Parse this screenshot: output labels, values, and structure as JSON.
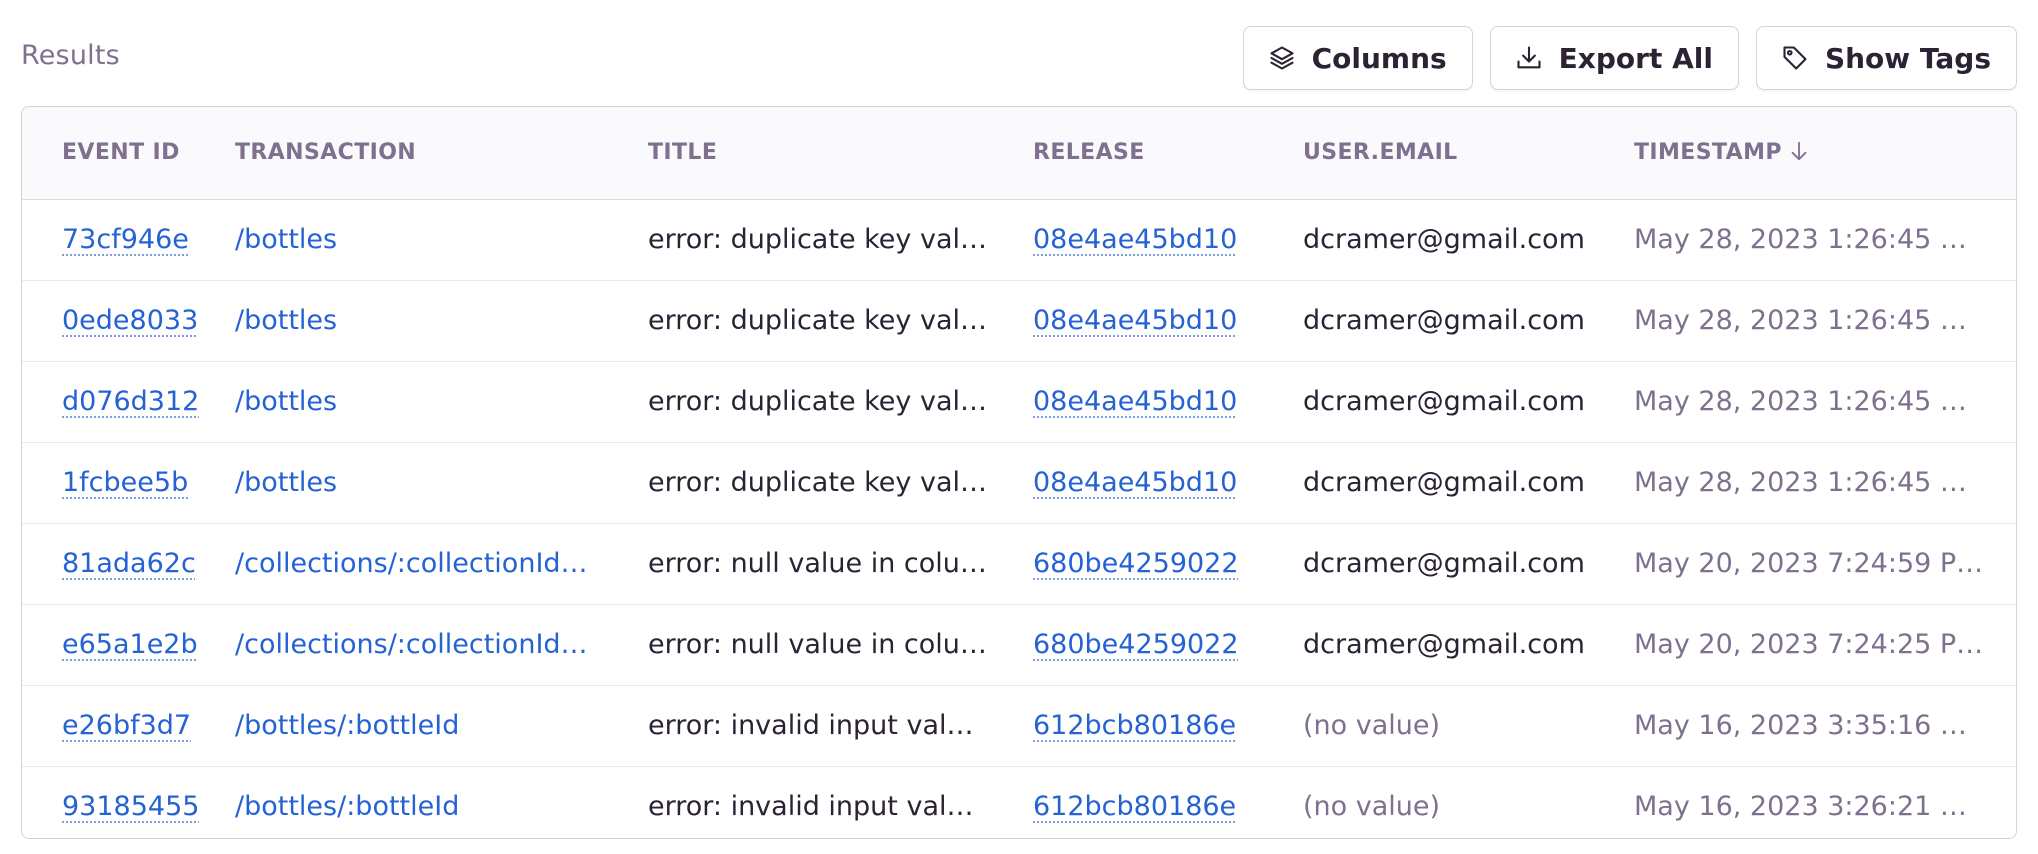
{
  "header": {
    "title": "Results",
    "buttons": {
      "columns": "Columns",
      "export_all": "Export All",
      "show_tags": "Show Tags"
    }
  },
  "table": {
    "columns": [
      "EVENT ID",
      "TRANSACTION",
      "TITLE",
      "RELEASE",
      "USER.EMAIL",
      "TIMESTAMP"
    ],
    "sort": {
      "column": "TIMESTAMP",
      "direction": "descending",
      "icon": "arrow-down-icon"
    },
    "rows": [
      {
        "event_id": "73cf946e",
        "transaction": "/bottles",
        "title": "error: duplicate key val…",
        "release": "08e4ae45bd10",
        "user_email": "dcramer@gmail.com",
        "timestamp": "May 28, 2023 1:26:45 A…"
      },
      {
        "event_id": "0ede8033",
        "transaction": "/bottles",
        "title": "error: duplicate key val…",
        "release": "08e4ae45bd10",
        "user_email": "dcramer@gmail.com",
        "timestamp": "May 28, 2023 1:26:45 A…"
      },
      {
        "event_id": "d076d312",
        "transaction": "/bottles",
        "title": "error: duplicate key val…",
        "release": "08e4ae45bd10",
        "user_email": "dcramer@gmail.com",
        "timestamp": "May 28, 2023 1:26:45 A…"
      },
      {
        "event_id": "1fcbee5b",
        "transaction": "/bottles",
        "title": "error: duplicate key val…",
        "release": "08e4ae45bd10",
        "user_email": "dcramer@gmail.com",
        "timestamp": "May 28, 2023 1:26:45 A…"
      },
      {
        "event_id": "81ada62c",
        "transaction": "/collections/:collectionId…",
        "title": "error: null value in colu…",
        "release": "680be4259022",
        "user_email": "dcramer@gmail.com",
        "timestamp": "May 20, 2023 7:24:59 P…"
      },
      {
        "event_id": "e65a1e2b",
        "transaction": "/collections/:collectionId…",
        "title": "error: null value in colu…",
        "release": "680be4259022",
        "user_email": "dcramer@gmail.com",
        "timestamp": "May 20, 2023 7:24:25 P…"
      },
      {
        "event_id": "e26bf3d7",
        "transaction": "/bottles/:bottleId",
        "title": "error: invalid input valu…",
        "release": "612bcb80186e",
        "user_email": "(no value)",
        "timestamp": "May 16, 2023 3:35:16 A…"
      },
      {
        "event_id": "93185455",
        "transaction": "/bottles/:bottleId",
        "title": "error: invalid input valu…",
        "release": "612bcb80186e",
        "user_email": "(no value)",
        "timestamp": "May 16, 2023 3:26:21 A…"
      }
    ]
  },
  "colors": {
    "link": "#2562d4",
    "muted_text": "#80708f",
    "body_text": "#2b2233",
    "border": "#d6d0dc",
    "header_bg": "#faf9fb"
  },
  "icons": {
    "columns": "layers-icon",
    "export_all": "download-icon",
    "show_tags": "tag-icon"
  }
}
